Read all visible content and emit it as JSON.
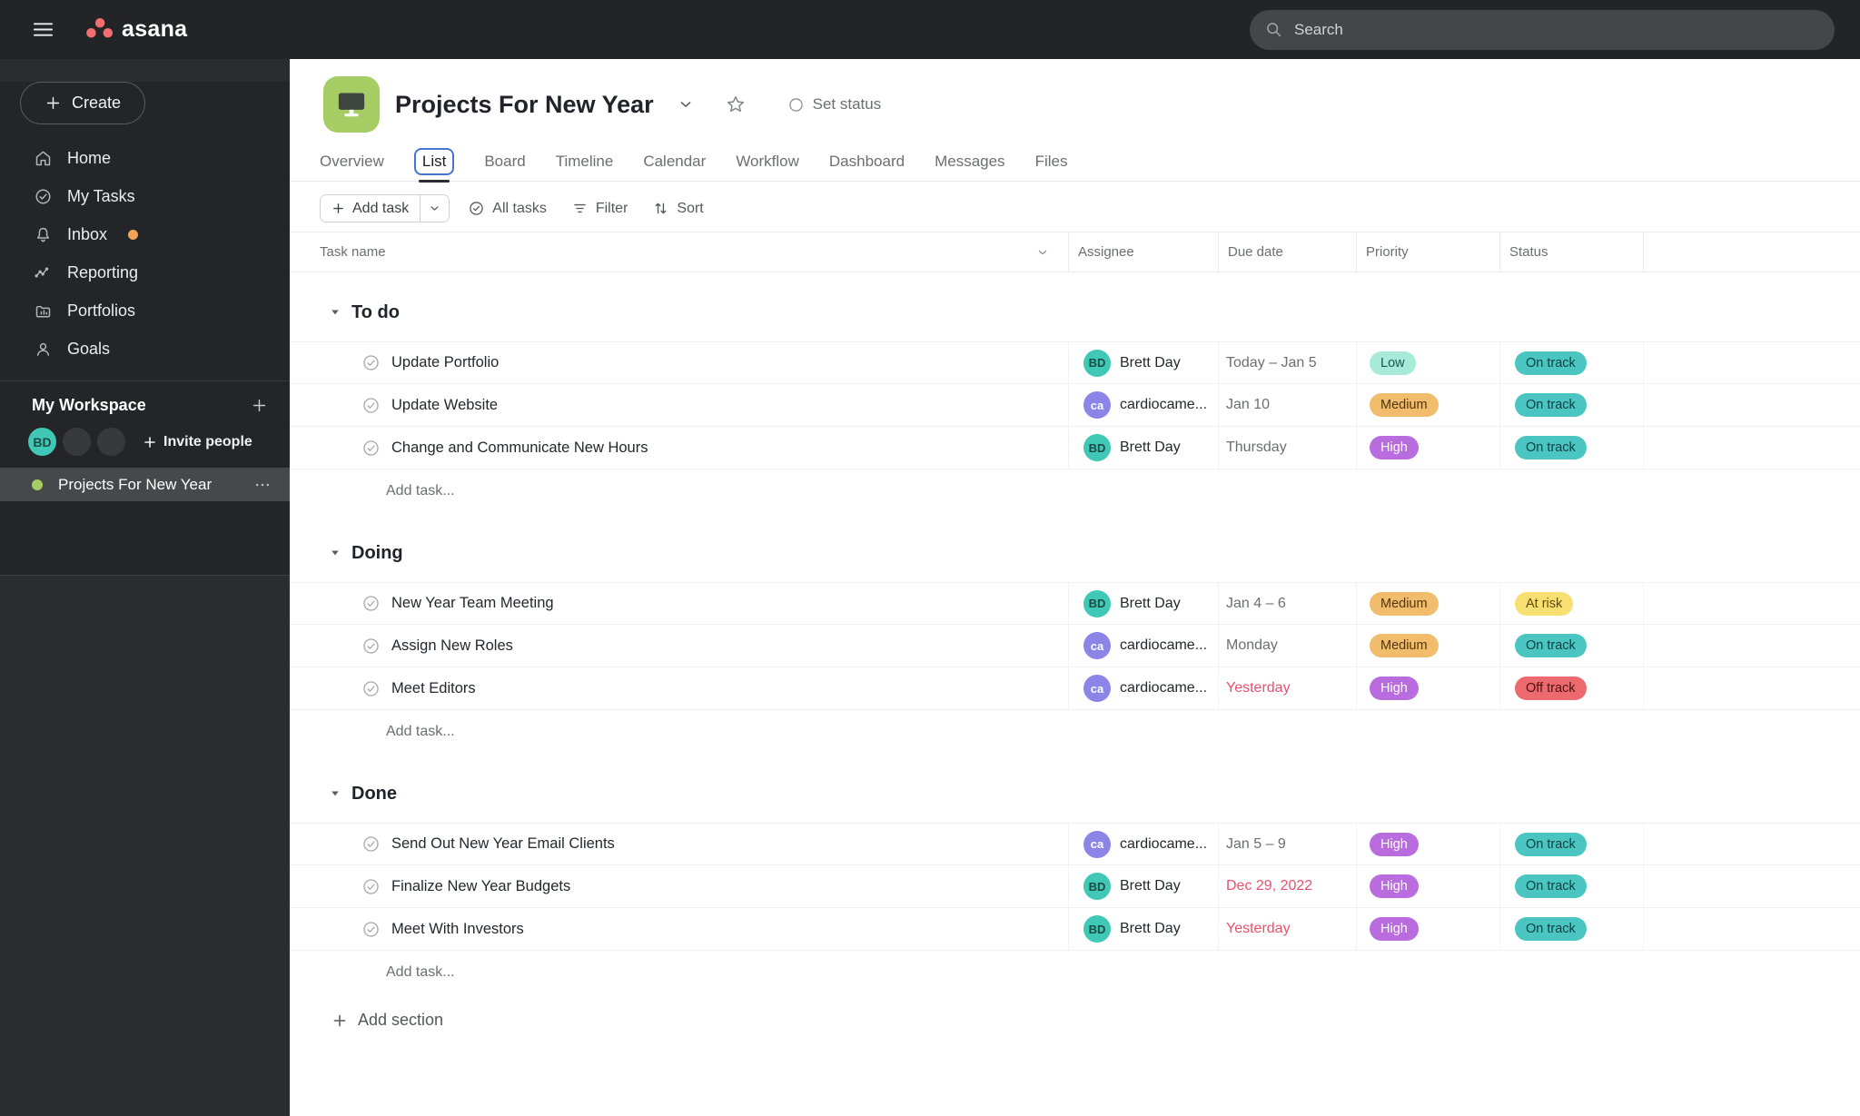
{
  "topbar": {
    "logo_text": "asana",
    "search_placeholder": "Search"
  },
  "sidebar": {
    "create_label": "Create",
    "nav": [
      {
        "label": "Home",
        "icon": "home"
      },
      {
        "label": "My Tasks",
        "icon": "check-circle"
      },
      {
        "label": "Inbox",
        "icon": "bell",
        "badge_dot": true
      },
      {
        "label": "Reporting",
        "icon": "trend"
      },
      {
        "label": "Portfolios",
        "icon": "portfolio"
      },
      {
        "label": "Goals",
        "icon": "person"
      }
    ],
    "workspace": {
      "title": "My Workspace",
      "member_initials": "BD",
      "placeholder_avatars": 2,
      "invite_label": "Invite people",
      "project": {
        "name": "Projects For New Year",
        "selected": true
      }
    }
  },
  "header": {
    "title": "Projects For New Year",
    "set_status_label": "Set status",
    "tabs": [
      "Overview",
      "List",
      "Board",
      "Timeline",
      "Calendar",
      "Workflow",
      "Dashboard",
      "Messages",
      "Files"
    ],
    "active_tab": "List"
  },
  "toolbar": {
    "add_task": "Add task",
    "all_tasks": "All tasks",
    "filter": "Filter",
    "sort": "Sort"
  },
  "table": {
    "columns": [
      "Task name",
      "Assignee",
      "Due date",
      "Priority",
      "Status"
    ],
    "add_task_label": "Add task...",
    "add_section_label": "Add section",
    "sections": [
      {
        "name": "To do",
        "tasks": [
          {
            "name": "Update Portfolio",
            "assignee": "Brett Day",
            "initials": "BD",
            "avatar": "teal",
            "due": "Today – Jan 5",
            "overdue": false,
            "priority": "Low",
            "status": "On track"
          },
          {
            "name": "Update Website",
            "assignee": "cardiocame...",
            "initials": "ca",
            "avatar": "purple",
            "due": "Jan 10",
            "overdue": false,
            "priority": "Medium",
            "status": "On track"
          },
          {
            "name": "Change and Communicate New Hours",
            "assignee": "Brett Day",
            "initials": "BD",
            "avatar": "teal",
            "due": "Thursday",
            "overdue": false,
            "priority": "High",
            "status": "On track"
          }
        ]
      },
      {
        "name": "Doing",
        "tasks": [
          {
            "name": "New Year Team Meeting",
            "assignee": "Brett Day",
            "initials": "BD",
            "avatar": "teal",
            "due": "Jan 4 – 6",
            "overdue": false,
            "priority": "Medium",
            "status": "At risk"
          },
          {
            "name": "Assign New Roles",
            "assignee": "cardiocame...",
            "initials": "ca",
            "avatar": "purple",
            "due": "Monday",
            "overdue": false,
            "priority": "Medium",
            "status": "On track"
          },
          {
            "name": "Meet Editors",
            "assignee": "cardiocame...",
            "initials": "ca",
            "avatar": "purple",
            "due": "Yesterday",
            "overdue": true,
            "priority": "High",
            "status": "Off track"
          }
        ]
      },
      {
        "name": "Done",
        "tasks": [
          {
            "name": "Send Out New Year Email Clients",
            "assignee": "cardiocame...",
            "initials": "ca",
            "avatar": "purple",
            "due": "Jan 5 – 9",
            "overdue": false,
            "priority": "High",
            "status": "On track"
          },
          {
            "name": "Finalize New Year Budgets",
            "assignee": "Brett Day",
            "initials": "BD",
            "avatar": "teal",
            "due": "Dec 29, 2022",
            "overdue": true,
            "priority": "High",
            "status": "On track"
          },
          {
            "name": "Meet With Investors",
            "assignee": "Brett Day",
            "initials": "BD",
            "avatar": "teal",
            "due": "Yesterday",
            "overdue": true,
            "priority": "High",
            "status": "On track"
          }
        ]
      }
    ]
  },
  "colors": {
    "logo_dots": "#f26d6d",
    "accent_blue": "#4573D2",
    "project_icon_bg": "#a5cd63",
    "project_dot": "#a5cd63",
    "inbox_dot": "#f2a356",
    "overdue_text": "#E8516D",
    "priority": {
      "Low": {
        "bg": "#A8EAD8",
        "fg": "#1d5549"
      },
      "Medium": {
        "bg": "#F1BD6C",
        "fg": "#50360b"
      },
      "High": {
        "bg": "#B96CDE",
        "fg": "#ffffff"
      }
    },
    "status": {
      "On track": {
        "bg": "#4BC5C2",
        "fg": "#123f3d"
      },
      "At risk": {
        "bg": "#F8DF72",
        "fg": "#5b4d08"
      },
      "Off track": {
        "bg": "#EC696D",
        "fg": "#4c1215"
      }
    },
    "avatar": {
      "teal": {
        "bg": "#3FC8B6",
        "fg": "#1d4a44"
      },
      "purple": {
        "bg": "#8D84E8",
        "fg": "#ffffff"
      }
    }
  }
}
